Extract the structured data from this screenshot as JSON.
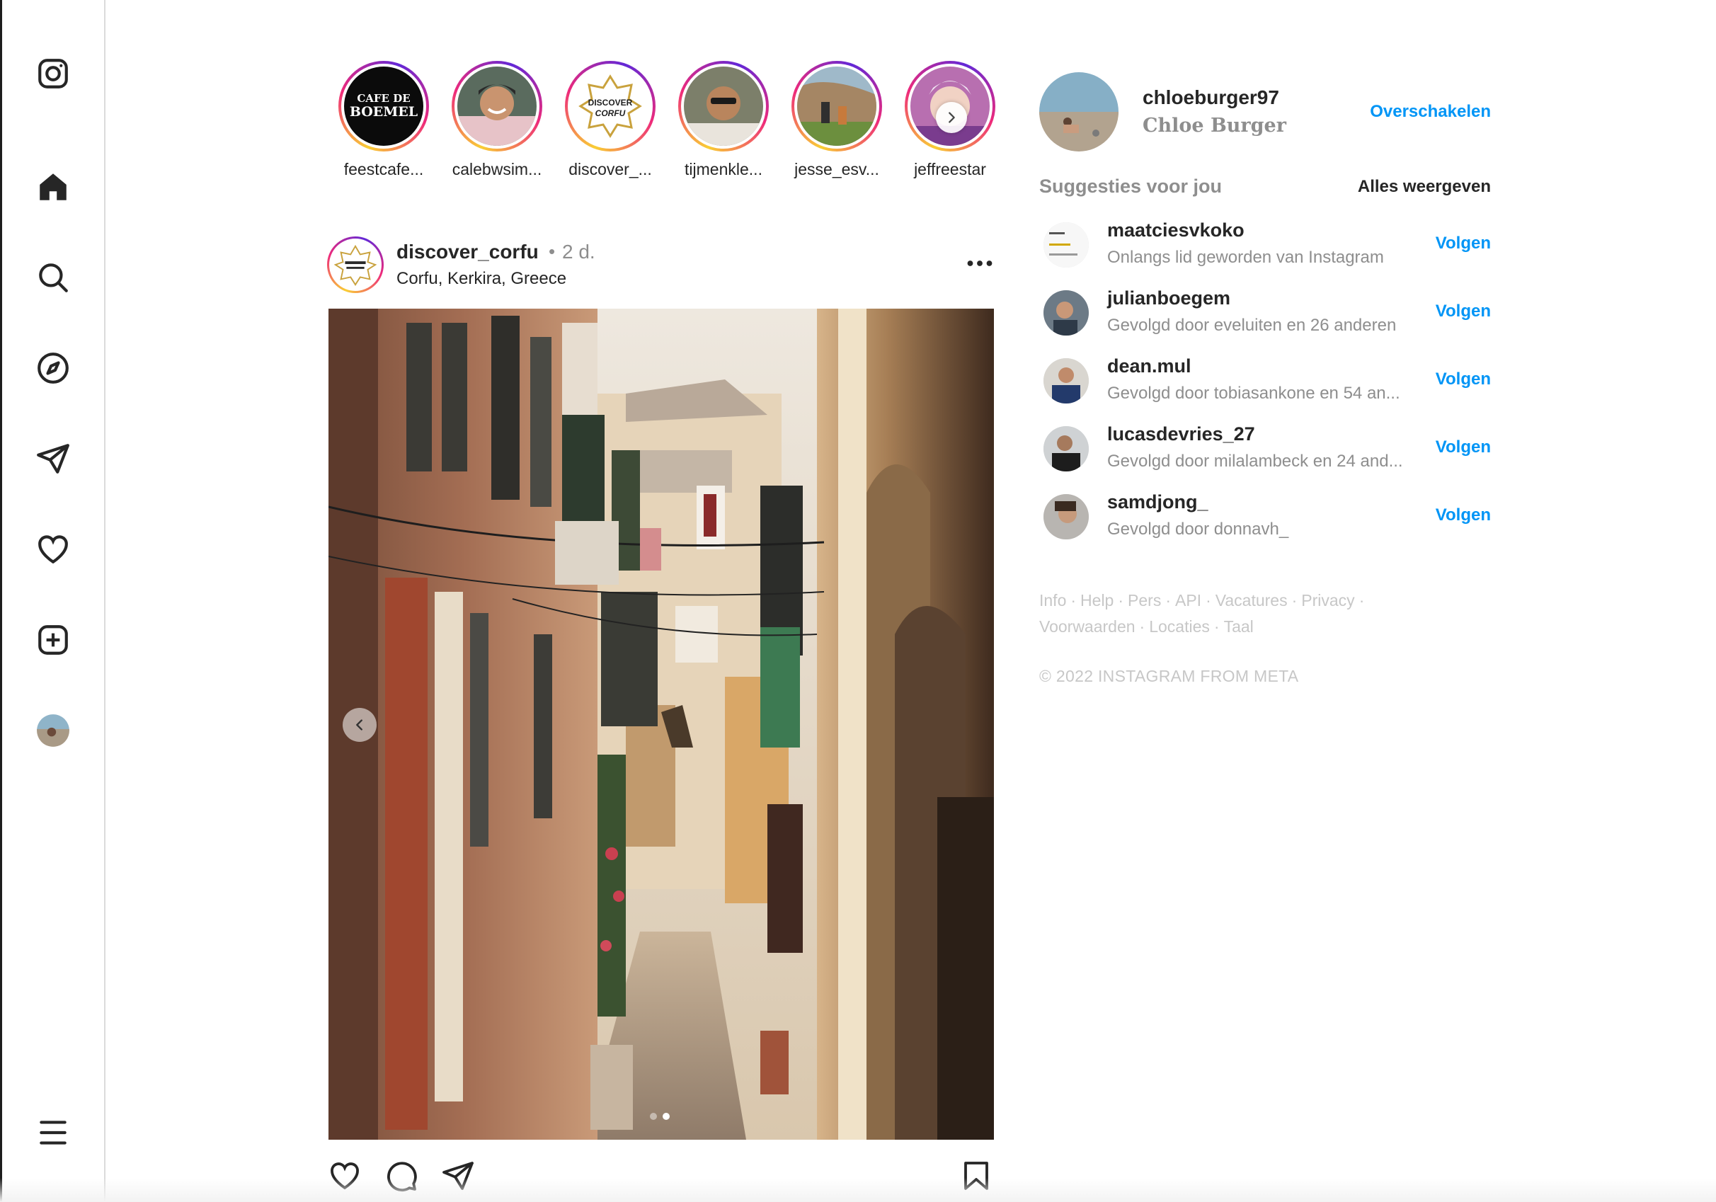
{
  "sidebar": {
    "items": [
      {
        "name": "instagram-logo",
        "icon": "instagram-icon"
      },
      {
        "name": "home",
        "icon": "home-icon"
      },
      {
        "name": "search",
        "icon": "search-icon"
      },
      {
        "name": "explore",
        "icon": "compass-icon"
      },
      {
        "name": "messages",
        "icon": "paper-plane-icon"
      },
      {
        "name": "notifications",
        "icon": "heart-icon"
      },
      {
        "name": "create",
        "icon": "plus-square-icon"
      },
      {
        "name": "profile",
        "icon": "avatar"
      },
      {
        "name": "more",
        "icon": "menu-icon"
      }
    ]
  },
  "stories": [
    {
      "username": "feestcafe..."
    },
    {
      "username": "calebwsim..."
    },
    {
      "username": "discover_..."
    },
    {
      "username": "tijmenkle..."
    },
    {
      "username": "jesse_esv..."
    },
    {
      "username": "jeffreestar"
    }
  ],
  "story_logos": {
    "cafe_top": "CAFE DE",
    "cafe_main": "BOEMEL",
    "discover_top": "DISCOVER",
    "discover_bottom": "CORFU"
  },
  "post": {
    "username": "discover_corfu",
    "dot": "•",
    "time": "2 d.",
    "location": "Corfu, Kerkira, Greece",
    "carousel_index": 2,
    "carousel_count": 2
  },
  "profile": {
    "username": "chloeburger97",
    "display_name": "Chloe Burger",
    "switch_label": "Overschakelen"
  },
  "suggestions": {
    "title": "Suggesties voor jou",
    "see_all": "Alles weergeven",
    "follow_label": "Volgen",
    "items": [
      {
        "username": "maatciesvkoko",
        "subtitle": "Onlangs lid geworden van Instagram"
      },
      {
        "username": "julianboegem",
        "subtitle": "Gevolgd door eveluiten en 26 anderen"
      },
      {
        "username": "dean.mul",
        "subtitle": "Gevolgd door tobiasankone en 54 an..."
      },
      {
        "username": "lucasdevries_27",
        "subtitle": "Gevolgd door milalambeck en 24 and..."
      },
      {
        "username": "samdjong_",
        "subtitle": "Gevolgd door donnavh_"
      }
    ]
  },
  "footer": {
    "links": [
      "Info",
      "Help",
      "Pers",
      "API",
      "Vacatures",
      "Privacy",
      "Voorwaarden",
      "Locaties",
      "Taal"
    ],
    "separator": "·",
    "copyright": "© 2022 INSTAGRAM FROM META"
  },
  "colors": {
    "link_blue": "#0095f6",
    "secondary_text": "#8e8e8e",
    "border": "#dbdbdb"
  }
}
